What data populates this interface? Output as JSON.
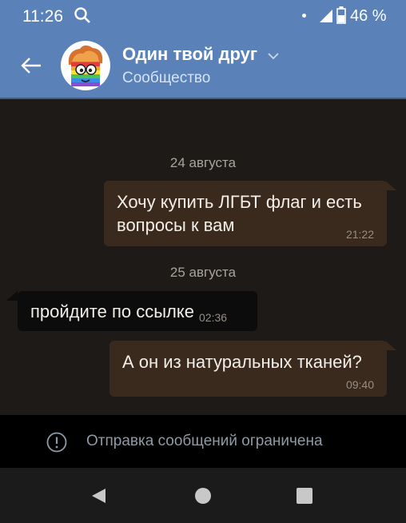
{
  "status_bar": {
    "time": "11:26",
    "battery": "46 %",
    "icons": [
      "search-icon",
      "notification-dot",
      "signal-icon",
      "battery-icon"
    ]
  },
  "header": {
    "title": "Один твой друг",
    "subtitle": "Сообщество",
    "icons": [
      "back-arrow-icon",
      "avatar",
      "chevron-down-icon"
    ]
  },
  "chat": {
    "dates": [
      "24 августа",
      "25 августа"
    ],
    "messages": [
      {
        "direction": "outgoing",
        "text": "Хочу купить ЛГБТ флаг и есть вопросы к вам",
        "time": "21:22"
      },
      {
        "direction": "incoming",
        "text": "пройдите по ссылке",
        "time": "02:36"
      },
      {
        "direction": "outgoing",
        "text": "А он из натуральных тканей?",
        "time": "09:40"
      }
    ]
  },
  "restriction": {
    "text": "Отправка сообщений ограничена",
    "icon": "info-icon"
  },
  "nav": {
    "icons": [
      "back-triangle-icon",
      "home-circle-icon",
      "recents-square-icon"
    ]
  },
  "colors": {
    "header_bg": "#5a82b8",
    "chat_bg": "#1e1a17",
    "outgoing_bubble": "#3a2a1e",
    "incoming_bubble": "#0c0c0c",
    "restriction_bg": "#000000",
    "nav_bg": "#1b1b1b"
  }
}
